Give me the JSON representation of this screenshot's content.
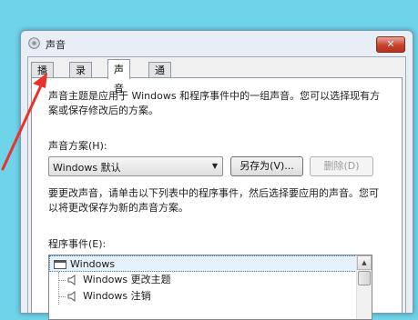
{
  "window": {
    "title": "声音",
    "close_label": "✕"
  },
  "tabs": [
    {
      "label": "播放",
      "active": false
    },
    {
      "label": "录制",
      "active": false
    },
    {
      "label": "声音",
      "active": true
    },
    {
      "label": "通信",
      "active": false
    }
  ],
  "panel": {
    "intro_line1": "声音主题是应用于 Windows 和程序事件中的一组声音。您可以选择现有方",
    "intro_line2": "案或保存修改后的方案。",
    "scheme_label": "声音方案(H):",
    "scheme_value": "Windows 默认",
    "save_as_label": "另存为(V)...",
    "delete_label": "删除(D)",
    "change_line1": "要更改声音，请单击以下列表中的程序事件，然后选择要应用的声音。您可",
    "change_line2": "以将更改保存为新的声音方案。",
    "events_label": "程序事件(E):",
    "events": [
      {
        "label": "Windows",
        "level": 0,
        "selected": true
      },
      {
        "label": "Windows 更改主题",
        "level": 1,
        "selected": false
      },
      {
        "label": "Windows 注销",
        "level": 1,
        "selected": false
      }
    ]
  },
  "annotation": {
    "color": "#e8322a"
  }
}
